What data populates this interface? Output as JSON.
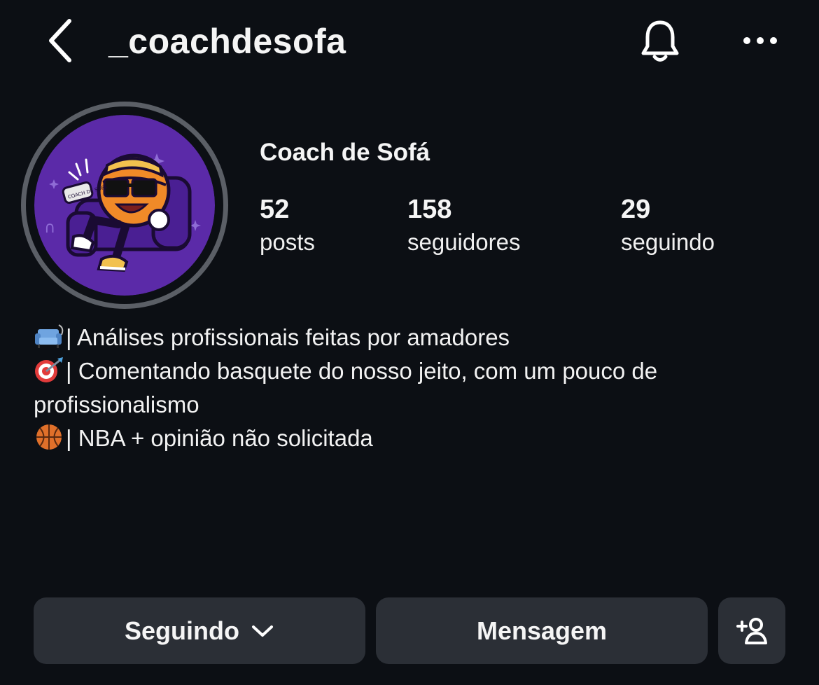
{
  "header": {
    "username": "_coachdesofa"
  },
  "profile": {
    "display_name": "Coach de Sofá",
    "avatar_caption": "COACH DE SOFÁ",
    "stats": [
      {
        "value": "52",
        "label": "posts"
      },
      {
        "value": "158",
        "label": "seguidores"
      },
      {
        "value": "29",
        "label": "seguindo"
      }
    ],
    "bio": [
      {
        "icon": "sofa-emoji",
        "text": "| Análises profissionais feitas por amadores"
      },
      {
        "icon": "target-dart-emoji",
        "text": "| Comentando basquete do nosso jeito, com um pouco de"
      },
      {
        "icon": "",
        "text": "profissionalismo"
      },
      {
        "icon": "basketball-emoji",
        "text": "| NBA + opinião não solicitada"
      }
    ]
  },
  "actions": {
    "following_label": "Seguindo",
    "message_label": "Mensagem"
  },
  "colors": {
    "background": "#0c0f14",
    "button": "#2b2f36",
    "avatar_purple": "#5b2aa8",
    "ring": "#5b5f66"
  }
}
